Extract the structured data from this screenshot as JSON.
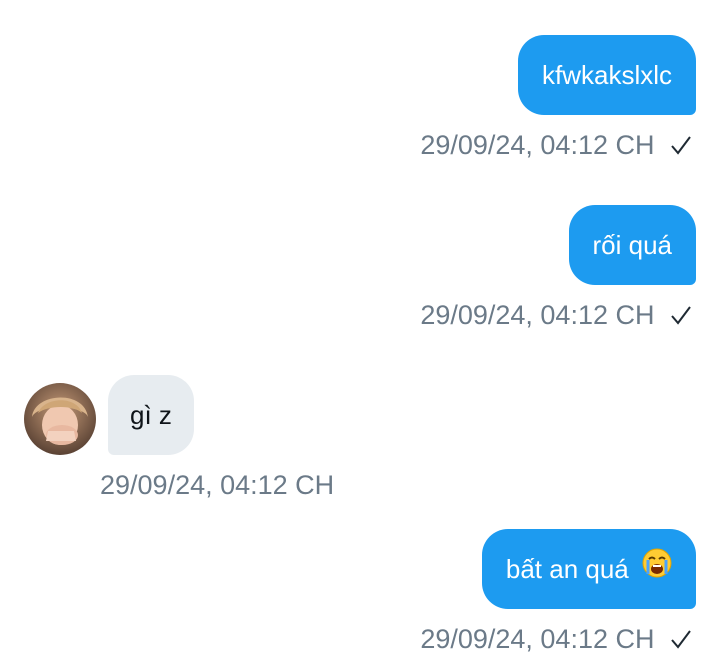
{
  "messages": [
    {
      "direction": "out",
      "text": "kfwkakslxlc",
      "timestamp": "29/09/24, 04:12 CH",
      "status_icon": "sent-check-icon"
    },
    {
      "direction": "out",
      "text": "rối quá",
      "timestamp": "29/09/24, 04:12 CH",
      "status_icon": "sent-check-icon"
    },
    {
      "direction": "in",
      "text": "gì z",
      "timestamp": "29/09/24, 04:12 CH",
      "sender_avatar": "user-avatar"
    },
    {
      "direction": "out",
      "text": "bất an quá",
      "emoji": "loudly-crying-face-emoji",
      "timestamp": "29/09/24, 04:12 CH",
      "status_icon": "sent-check-icon"
    }
  ],
  "colors": {
    "outgoing_bubble": "#1d9bf0",
    "incoming_bubble": "#e7ecf0",
    "timestamp_text": "#6b7a88",
    "background": "#ffffff"
  }
}
